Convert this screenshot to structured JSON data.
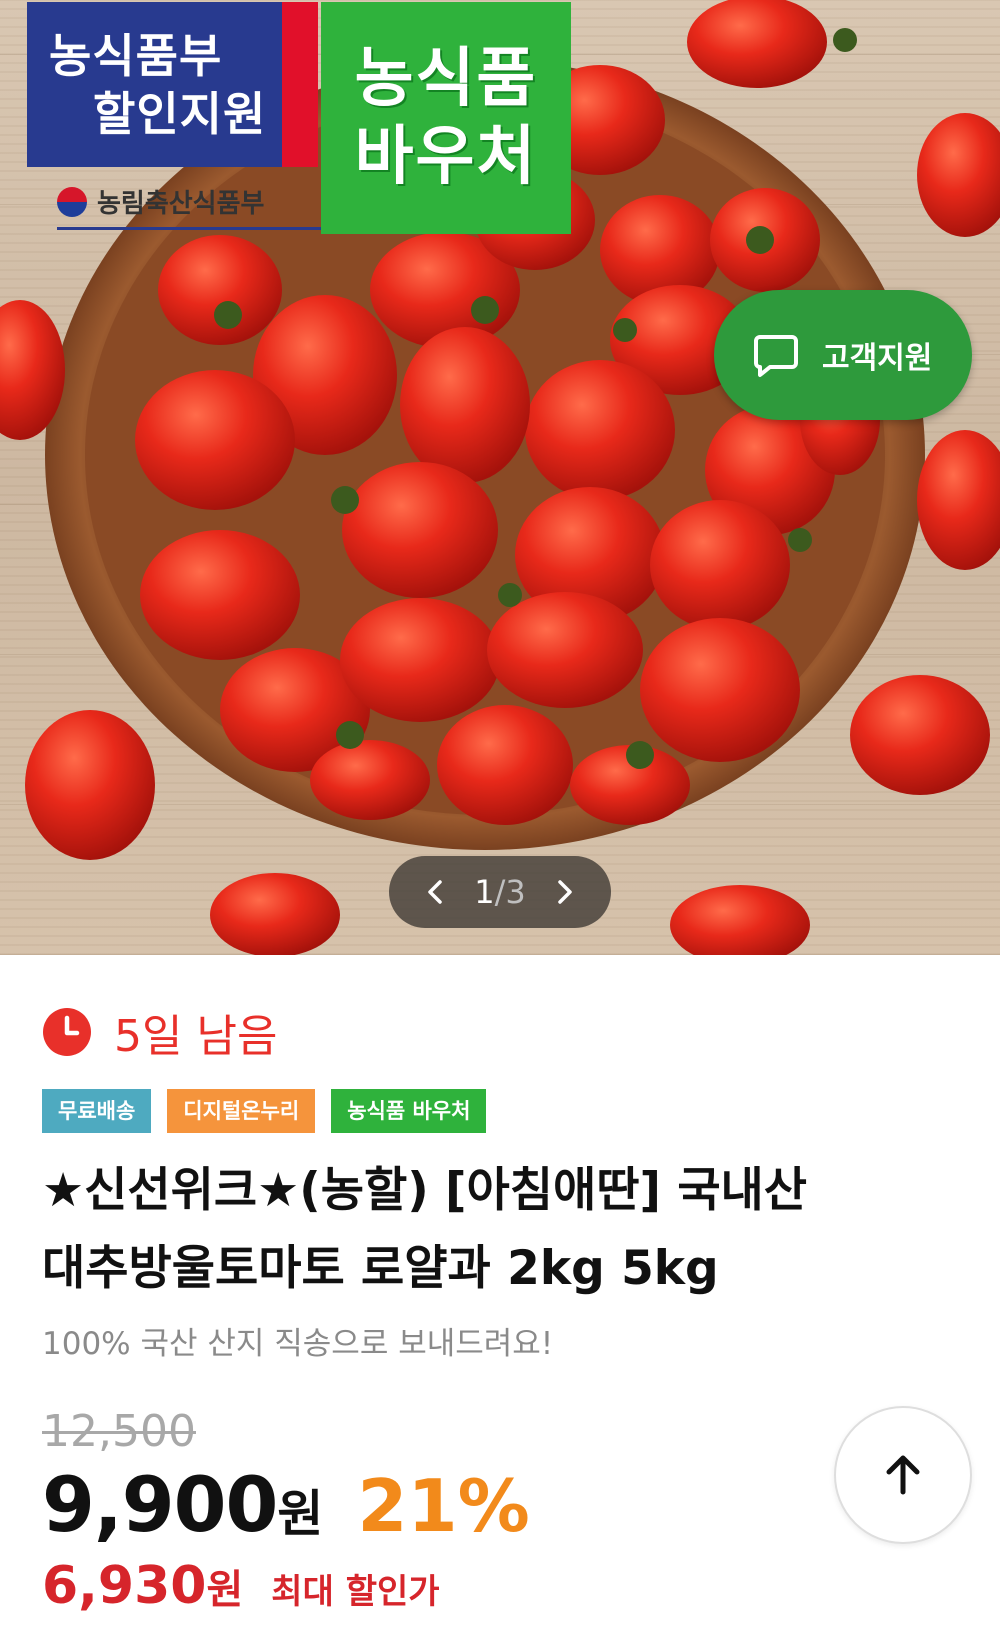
{
  "badges": {
    "gov_line1": "농식품부",
    "gov_line2": "할인지원",
    "ministry": "농림축산식품부",
    "voucher_line1": "농식품",
    "voucher_line2": "바우처"
  },
  "support_button": {
    "label": "고객지원",
    "icon": "chat-bubble-icon"
  },
  "pager": {
    "current": "1",
    "separator": "/",
    "total": "3",
    "prev_icon": "chevron-left-icon",
    "next_icon": "chevron-right-icon"
  },
  "countdown": {
    "text": "5일 남음",
    "icon": "clock-icon",
    "color": "#e8302a"
  },
  "tags": [
    {
      "label": "무료배송",
      "color": "#4eaac0"
    },
    {
      "label": "디지털온누리",
      "color": "#f5943c"
    },
    {
      "label": "농식품 바우처",
      "color": "#2fb23c"
    }
  ],
  "product": {
    "title_line1": "★신선위크★(농할) [아침애딴] 국내산",
    "title_line2": "대추방울토마토 로얄과 2kg 5kg",
    "subtitle": "100% 국산 산지 직송으로 보내드려요!"
  },
  "pricing": {
    "original": "12,500",
    "price": "9,900",
    "currency": "원",
    "discount": "21%",
    "max_price": "6,930",
    "max_label": "최대 할인가"
  },
  "scroll_top": {
    "icon": "arrow-up-icon"
  },
  "colors": {
    "brand_green": "#2e9a3c",
    "discount_orange": "#f28a1b",
    "max_red": "#d6252b"
  }
}
